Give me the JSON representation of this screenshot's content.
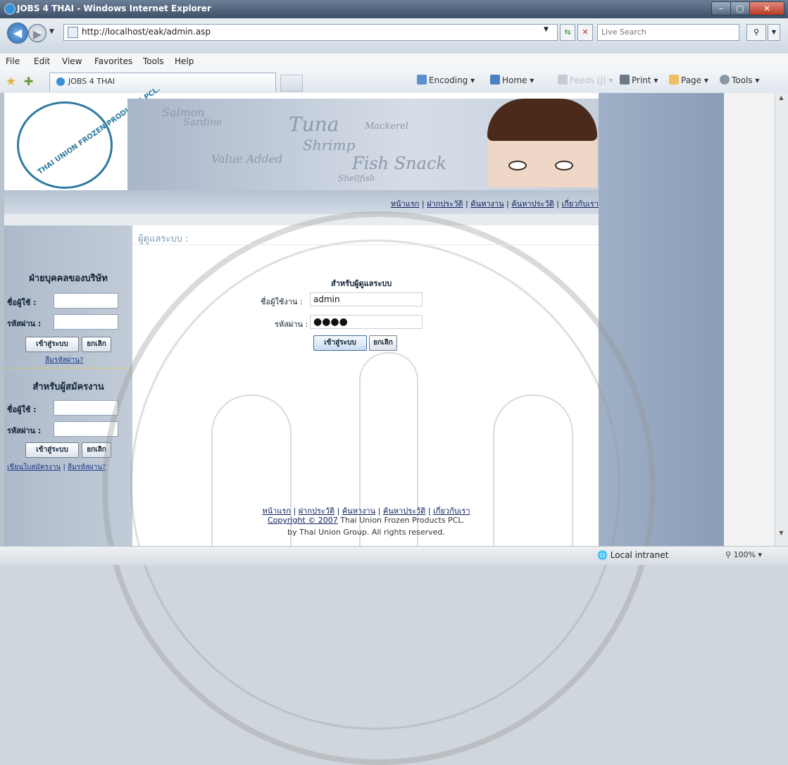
{
  "window": {
    "title": "JOBS 4 THAI - Windows Internet Explorer",
    "btn_min": "–",
    "btn_max": "▢",
    "btn_close": "✕"
  },
  "address": {
    "url": "http://localhost/eak/admin.asp",
    "search_placeholder": "Live Search"
  },
  "menu": [
    "File",
    "Edit",
    "View",
    "Favorites",
    "Tools",
    "Help"
  ],
  "tab": {
    "label": "JOBS 4 THAI"
  },
  "commands": {
    "encoding": "Encoding",
    "home": "Home",
    "feeds": "Feeds (J)",
    "print": "Print",
    "page": "Page",
    "tools": "Tools"
  },
  "header": {
    "logo_text": "THAI UNION FROZEN PRODUCTS PCL.",
    "banner_words": [
      "Salmon",
      "Sardine",
      "Tuna",
      "Mackerel",
      "Shrimp",
      "Value Added",
      "Fish Snack",
      "Shellfish"
    ],
    "topnav": [
      "หน้าแรก",
      "ฝากประวัติ",
      "ค้นหางาน",
      "ค้นหาประวัติ",
      "เกี่ยวกับเรา"
    ]
  },
  "sidebar": {
    "company_heading": "ฝ่ายบุคคลของบริษัท",
    "applicant_heading": "สำหรับผู้สมัครงาน",
    "username_label": "ชื่อผู้ใช้ :",
    "password_label": "รหัสผ่าน :",
    "login_label": "เข้าสู่ระบบ",
    "cancel_label": "ยกเลิก",
    "forgot_label": "ลืมรหัสผ่าน?",
    "register_label": "เขียนใบสมัครงาน",
    "forgot_label2": "ลืมรหัสผ่าน?"
  },
  "main": {
    "title": "ผู้ดูแลระบบ :",
    "admin_heading": "สำหรับผู้ดูแลระบบ",
    "username_label": "ชื่อผู้ใช้งาน :",
    "password_label": "รหัสผ่าน :",
    "username_value": "admin",
    "password_value": "●●●●",
    "login_label": "เข้าสู่ระบบ",
    "cancel_label": "ยกเลิก"
  },
  "footer": {
    "links": [
      "หน้าแรก",
      "ฝากประวัติ",
      "ค้นหางาน",
      "ค้นหาประวัติ",
      "เกี่ยวกับเรา"
    ],
    "copyright_link": "Copyright © 2007",
    "copyright_rest": "Thai Union Frozen Products PCL.",
    "group": "by Thai Union Group. All rights reserved."
  },
  "status": {
    "zone": "Local intranet",
    "zoom": "100%"
  }
}
